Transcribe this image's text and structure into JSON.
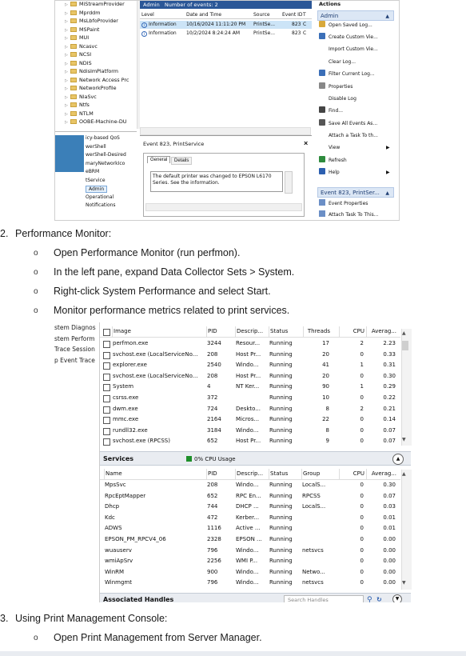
{
  "event_viewer": {
    "tree_items": [
      "MiStreamProvider",
      "Mprddm",
      "MsLbfoProvider",
      "MSPaint",
      "MUI",
      "Ncasvc",
      "NCSI",
      "NDIS",
      "NdisImPlatform",
      "Network Access Prc",
      "NetworkProfile",
      "NlaSvc",
      "Ntfs",
      "NTLM",
      "OOBE-Machine-DU"
    ],
    "tree_sub_items": [
      "icy-based QoS",
      "werShell",
      "werShell-Desired",
      "maryNetworkIco",
      "eBRM",
      "tService",
      "Admin",
      "Operational",
      "Notifications"
    ],
    "header": "Admin",
    "header_count": "Number of events: 2",
    "columns": [
      "Level",
      "Date and Time",
      "Source",
      "Event ID",
      "T"
    ],
    "rows": [
      {
        "level": "Information",
        "date": "10/16/2024 11:11:20 PM",
        "source": "PrintSe...",
        "id": "823",
        "t": "C"
      },
      {
        "level": "Information",
        "date": "10/2/2024 8:24:24 AM",
        "source": "PrintSe...",
        "id": "823",
        "t": "C"
      }
    ],
    "event_title": "Event 823, PrintService",
    "tabs": [
      "General",
      "Details"
    ],
    "event_text": "The default printer was changed to EPSON L6170 Series. See the information.",
    "actions_title": "Actions",
    "actions_section": "Admin",
    "actions": [
      "Open Saved Log...",
      "Create Custom Vie...",
      "Import Custom Vie...",
      "Clear Log...",
      "Filter Current Log...",
      "Properties",
      "Disable Log",
      "Find...",
      "Save All Events As...",
      "Attach a Task To th...",
      "View",
      "Refresh",
      "Help"
    ],
    "actions_section2": "Event 823, PrintSer...",
    "actions2": [
      "Event Properties",
      "Attach Task To This..."
    ]
  },
  "steps": {
    "step2_num": "2.",
    "step2_title": "Performance Monitor:",
    "step2_bullets": [
      "Open Performance Monitor (run perfmon).",
      "In the left pane, expand Data Collector Sets > System.",
      "Right-click System Performance and select Start.",
      "Monitor performance metrics related to print services."
    ],
    "step3_num": "3.",
    "step3_title": "Using Print Management Console:",
    "step3_bullets": [
      "Open Print Management from Server Manager."
    ],
    "bullet_char": "o"
  },
  "resmon": {
    "side_items": [
      "stem Diagnos",
      "stem Perform",
      "Trace Session",
      "p Event Trace"
    ],
    "proc_columns": [
      "Image",
      "PID",
      "Descrip...",
      "Status",
      "Threads",
      "CPU",
      "Averag..."
    ],
    "processes": [
      [
        "perfmon.exe",
        "3244",
        "Resour...",
        "Running",
        "17",
        "2",
        "2.23"
      ],
      [
        "svchost.exe (LocalServiceNo...",
        "208",
        "Host Pr...",
        "Running",
        "20",
        "0",
        "0.33"
      ],
      [
        "explorer.exe",
        "2540",
        "Windo...",
        "Running",
        "41",
        "1",
        "0.31"
      ],
      [
        "svchost.exe (LocalServiceNo...",
        "208",
        "Host Pr...",
        "Running",
        "20",
        "0",
        "0.30"
      ],
      [
        "System",
        "4",
        "NT Ker...",
        "Running",
        "90",
        "1",
        "0.29"
      ],
      [
        "csrss.exe",
        "372",
        "",
        "Running",
        "10",
        "0",
        "0.22"
      ],
      [
        "dwm.exe",
        "724",
        "Deskto...",
        "Running",
        "8",
        "2",
        "0.21"
      ],
      [
        "mmc.exe",
        "2164",
        "Micros...",
        "Running",
        "22",
        "0",
        "0.14"
      ],
      [
        "rundll32.exe",
        "3184",
        "Windo...",
        "Running",
        "8",
        "0",
        "0.07"
      ],
      [
        "svchost.exe (RPCSS)",
        "652",
        "Host Pr...",
        "Running",
        "9",
        "0",
        "0.07"
      ]
    ],
    "services_title": "Services",
    "services_usage": "0% CPU Usage",
    "svc_columns": [
      "Name",
      "PID",
      "Descrip...",
      "Status",
      "Group",
      "CPU",
      "Averag..."
    ],
    "services": [
      [
        "MpsSvc",
        "208",
        "Windo...",
        "Running",
        "LocalS...",
        "0",
        "0.30"
      ],
      [
        "RpcEptMapper",
        "652",
        "RPC En...",
        "Running",
        "RPCSS",
        "0",
        "0.07"
      ],
      [
        "Dhcp",
        "744",
        "DHCP ...",
        "Running",
        "LocalS...",
        "0",
        "0.03"
      ],
      [
        "Kdc",
        "472",
        "Kerber...",
        "Running",
        "",
        "0",
        "0.01"
      ],
      [
        "ADWS",
        "1116",
        "Active ...",
        "Running",
        "",
        "0",
        "0.01"
      ],
      [
        "EPSON_PM_RPCV4_06",
        "2328",
        "EPSON ...",
        "Running",
        "",
        "0",
        "0.00"
      ],
      [
        "wuauserv",
        "796",
        "Windo...",
        "Running",
        "netsvcs",
        "0",
        "0.00"
      ],
      [
        "wmiApSrv",
        "2256",
        "WMI P...",
        "Running",
        "",
        "0",
        "0.00"
      ],
      [
        "WinRM",
        "900",
        "Windo...",
        "Running",
        "Netwo...",
        "0",
        "0.00"
      ],
      [
        "Winmgmt",
        "796",
        "Windo...",
        "Running",
        "netsvcs",
        "0",
        "0.00"
      ]
    ],
    "handles_title": "Associated Handles",
    "search_placeholder": "Search Handles"
  }
}
